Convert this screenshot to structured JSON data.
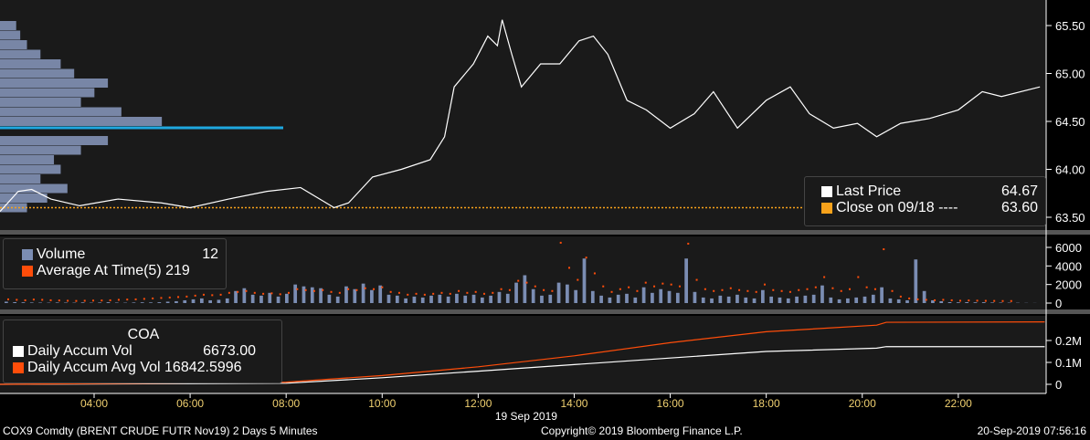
{
  "chart_data": [
    {
      "type": "line",
      "pane": "price",
      "series": [
        {
          "name": "Last Price",
          "color": "#ffffff",
          "x": [
            2.04,
            2.42,
            2.7,
            3.1,
            3.7,
            4.5,
            5.4,
            6.0,
            6.8,
            7.6,
            8.3,
            9.0,
            9.3,
            9.8,
            10.4,
            11.0,
            11.3,
            11.5,
            11.9,
            12.2,
            12.4,
            12.5,
            12.7,
            12.9,
            13.3,
            13.7,
            14.1,
            14.4,
            14.7,
            15.1,
            15.5,
            16.0,
            16.5,
            16.9,
            17.4,
            18.0,
            18.5,
            18.9,
            19.4,
            19.9,
            20.3,
            20.8,
            21.4,
            22.0,
            22.5,
            22.9,
            23.7
          ],
          "y": [
            63.56,
            63.77,
            63.79,
            63.69,
            63.62,
            63.69,
            63.65,
            63.6,
            63.69,
            63.77,
            63.81,
            63.6,
            63.65,
            63.92,
            64.0,
            64.1,
            64.34,
            64.86,
            65.1,
            65.39,
            65.29,
            65.56,
            65.2,
            64.86,
            65.1,
            65.1,
            65.34,
            65.39,
            65.2,
            64.72,
            64.62,
            64.43,
            64.58,
            64.81,
            64.43,
            64.72,
            64.86,
            64.58,
            64.43,
            64.48,
            64.34,
            64.48,
            64.53,
            64.62,
            64.81,
            64.76,
            64.86
          ]
        },
        {
          "name": "Close on 09/18",
          "color": "#f7a21b",
          "value": 63.6
        }
      ],
      "volume_profile": {
        "prices": [
          65.5,
          65.4,
          65.3,
          65.2,
          65.1,
          65.0,
          64.9,
          64.8,
          64.7,
          64.6,
          64.5,
          64.4,
          64.3,
          64.2,
          64.1,
          64.0,
          63.9,
          63.8,
          63.7,
          63.6
        ],
        "values": [
          12,
          15,
          20,
          30,
          45,
          55,
          80,
          70,
          60,
          90,
          120,
          210,
          80,
          60,
          40,
          45,
          30,
          50,
          35,
          20
        ],
        "highlight_price": 64.4
      },
      "yticks": [
        "65.50",
        "65.00",
        "64.50",
        "64.00",
        "63.50"
      ],
      "ylim": [
        63.45,
        65.6
      ],
      "legend": {
        "last_price_label": "Last Price",
        "last_price_value": "64.67",
        "close_label": "Close on 09/18 ----",
        "close_value": "63.60"
      }
    },
    {
      "type": "bar",
      "pane": "volume",
      "values": [
        150,
        100,
        80,
        60,
        50,
        40,
        60,
        50,
        40,
        70,
        40,
        60,
        90,
        50,
        40,
        60,
        80,
        70,
        90,
        150,
        200,
        300,
        400,
        500,
        300,
        350,
        500,
        1300,
        1600,
        900,
        800,
        1100,
        700,
        1000,
        2000,
        1800,
        1700,
        1600,
        900,
        700,
        1800,
        1500,
        2100,
        1400,
        1900,
        900,
        800,
        500,
        700,
        600,
        800,
        900,
        700,
        1000,
        800,
        900,
        600,
        800,
        1200,
        1000,
        2200,
        3000,
        1500,
        800,
        900,
        2200,
        2000,
        1400,
        4800,
        1300,
        800,
        600,
        900,
        1000,
        600,
        1700,
        1100,
        1500,
        1300,
        1100,
        4800,
        1200,
        600,
        500,
        800,
        700,
        900,
        600,
        500,
        1400,
        700,
        600,
        500,
        700,
        800,
        900,
        1900,
        600,
        400,
        500,
        600,
        700,
        900,
        1700,
        500,
        400,
        300,
        4700,
        1300,
        300,
        200,
        100,
        80,
        100,
        80,
        90,
        60,
        50,
        40,
        30,
        20,
        12
      ],
      "avg": [
        400,
        350,
        300,
        380,
        350,
        300,
        280,
        250,
        230,
        250,
        270,
        280,
        300,
        350,
        380,
        400,
        450,
        500,
        550,
        600,
        650,
        700,
        800,
        900,
        850,
        900,
        1100,
        1200,
        1300,
        1100,
        1000,
        1050,
        950,
        1100,
        1500,
        1400,
        1300,
        1400,
        1200,
        1100,
        1500,
        1400,
        1600,
        1500,
        1700,
        1200,
        1100,
        900,
        1000,
        900,
        1000,
        1100,
        1000,
        1300,
        1100,
        1200,
        1000,
        1100,
        1500,
        1400,
        2400,
        2200,
        1800,
        1400,
        1300,
        6500,
        3800,
        2500,
        4900,
        3200,
        1800,
        1200,
        1500,
        1700,
        1300,
        2200,
        1800,
        2100,
        2000,
        1800,
        6400,
        2500,
        1500,
        1300,
        1400,
        1600,
        1400,
        1300,
        1200,
        2000,
        1400,
        1300,
        1200,
        1400,
        1500,
        1700,
        2800,
        1600,
        1300,
        1500,
        2800,
        1700,
        1500,
        5800,
        1300,
        700,
        500,
        400,
        350,
        300,
        350,
        300,
        250,
        280,
        260,
        240,
        230,
        220,
        219
      ],
      "yticks": [
        "6000",
        "4000",
        "2000",
        "0"
      ],
      "ylim": [
        -500,
        6800
      ],
      "legend": {
        "volume_label": "Volume",
        "volume_value": "12",
        "avg_label": "Average At Time(5)",
        "avg_value": "219"
      }
    },
    {
      "type": "line",
      "pane": "accum",
      "series": [
        {
          "name": "Daily Accum Vol",
          "color": "#ffffff",
          "x": [
            2.04,
            8,
            10,
            12,
            14,
            16,
            18,
            20.3,
            20.5,
            23.8
          ],
          "y": [
            0,
            0.005,
            0.03,
            0.06,
            0.09,
            0.12,
            0.15,
            0.165,
            0.172,
            0.172
          ]
        },
        {
          "name": "Daily Accum Avg Vol",
          "color": "#ff4d0a",
          "x": [
            2.04,
            8,
            10,
            12,
            14,
            16,
            18,
            20.3,
            20.5,
            23.8
          ],
          "y": [
            0,
            0.01,
            0.04,
            0.08,
            0.13,
            0.19,
            0.24,
            0.27,
            0.283,
            0.285
          ]
        }
      ],
      "yticks": [
        "0.2M",
        "0.1M",
        "0"
      ],
      "ylim": [
        -0.02,
        0.31
      ],
      "legend": {
        "title": "COA",
        "accum_label": "Daily Accum Vol",
        "accum_value": "6673.00",
        "avg_label": "Daily Accum Avg Vol",
        "avg_value": "16842.5996"
      }
    }
  ],
  "xaxis": {
    "ticks": [
      "04:00",
      "06:00",
      "08:00",
      "10:00",
      "12:00",
      "14:00",
      "16:00",
      "18:00",
      "20:00",
      "22:00"
    ],
    "tick_hours": [
      4,
      6,
      8,
      10,
      12,
      14,
      16,
      18,
      20,
      22
    ],
    "range": [
      2.04,
      23.83
    ],
    "date_label": "19 Sep 2019"
  },
  "footer": {
    "left": "COX9 Comdty (BRENT CRUDE FUTR  Nov19) 2 Days 5 Minutes",
    "center": "Copyright© 2019 Bloomberg Finance L.P.",
    "right": "20-Sep-2019 07:56:16"
  }
}
